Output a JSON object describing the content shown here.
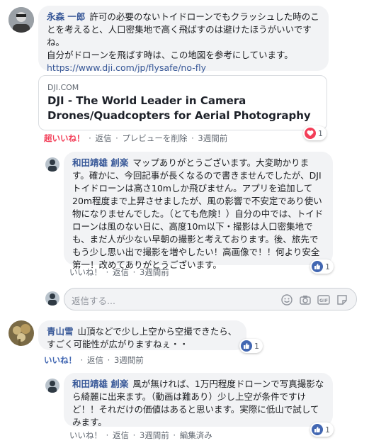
{
  "comments": [
    {
      "author": "永森 一郎",
      "text": "許可の必要のないトイドローンでもクラッシュした時のことを考えると、人口密集地で高く飛ばすのは避けたほうがいいですね。",
      "text2": "自分がドローンを飛ばす時は、この地図を参考にしています。",
      "link": "https://www.dji.com/jp/flysafe/no-fly",
      "card": {
        "domain": "DJI.COM",
        "title": "DJI - The World Leader in Camera Drones/Quadcopters for Aerial Photography"
      },
      "actions": {
        "like": "超いいね！",
        "reply": "返信",
        "remove_preview": "プレビューを削除",
        "time": "3週間前"
      },
      "reaction_count": "1"
    },
    {
      "author": "和田靖雄 創楽",
      "text": "マップありがとうございます。大変助かります。確かに、今回記事が長くなるので書きませんでしたが、DJIトイドローンは高さ10mしか飛びません。アプリを追加して20m程度まで上昇させましたが、風の影響で不安定であり使い物になりませんでした。（とても危険！）自分の中では、トイドローンは風のない日に、高度10m以下・撮影は人口密集地でも、まだ人が少ない早朝の撮影と考えております。後、旅先でもう少し思い出で撮影を増やしたい！高画像で！！何より安全第一！改めてありがとうございます。",
      "actions": {
        "like": "いいね！",
        "reply": "返信",
        "time": "3週間前"
      },
      "reaction_count": "1"
    },
    {
      "author": "青山雪",
      "text": "山頂などで少し上空から空撮できたら、すごく可能性が広がりますねぇ・・",
      "actions": {
        "like": "いいね！",
        "reply": "返信",
        "time": "3週間前"
      },
      "reaction_count": "1"
    },
    {
      "author": "和田靖雄 創楽",
      "text": "風が無ければ、1万円程度ドローンで写真撮影なら綺麗に出来ます。（動画は難あり）少し上空が条件ですけど！！それだけの価値はあると思います。実際に低山で試してみます。",
      "actions": {
        "like": "いいね！",
        "reply": "返信",
        "time": "3週間前",
        "edited": "編集済み"
      },
      "reaction_count": "1"
    }
  ],
  "reply_box": {
    "placeholder": "返信する..."
  },
  "icons": {
    "emoji": "smile-icon",
    "camera": "camera-icon",
    "gif": "gif-icon",
    "sticker": "sticker-icon"
  },
  "colors": {
    "author": "#385898",
    "like_blue": "#4267b2",
    "love_red": "#f33e58",
    "bubble": "#f2f3f5"
  },
  "gif_label": "GIF"
}
